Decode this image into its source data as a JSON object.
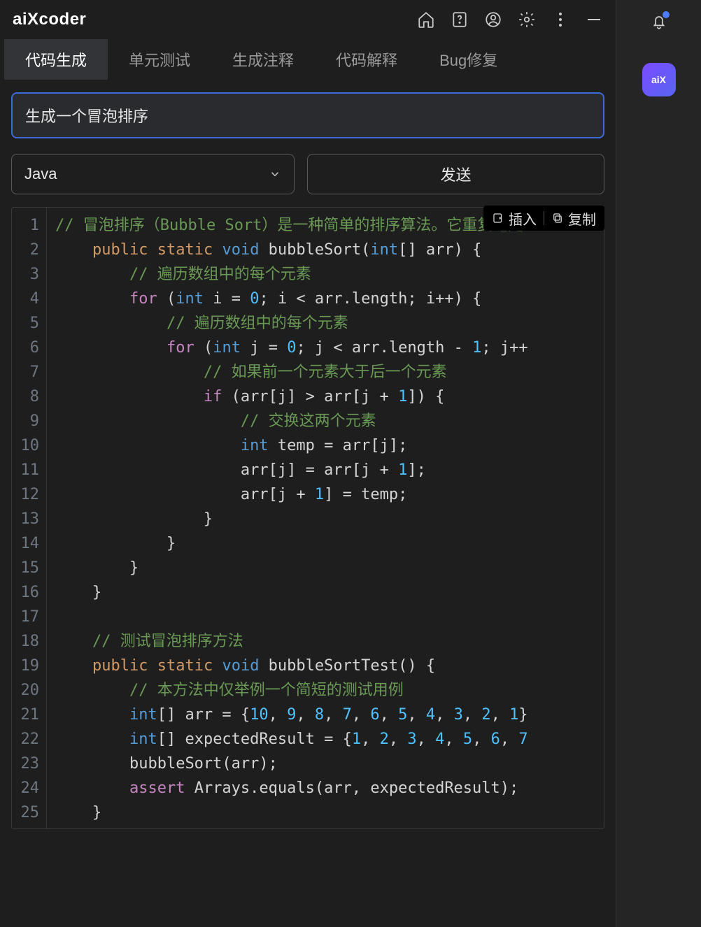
{
  "brand": "aiXcoder",
  "titlebar_icons": {
    "home": "home-icon",
    "help": "help-icon",
    "account": "account-icon",
    "settings": "settings-icon",
    "more": "more-icon",
    "minimize": "minimize-icon"
  },
  "tabs": [
    {
      "label": "代码生成",
      "active": true
    },
    {
      "label": "单元测试",
      "active": false
    },
    {
      "label": "生成注释",
      "active": false
    },
    {
      "label": "代码解释",
      "active": false
    },
    {
      "label": "Bug修复",
      "active": false
    }
  ],
  "prompt": {
    "value": "生成一个冒泡排序",
    "placeholder": ""
  },
  "language": {
    "selected": "Java"
  },
  "send_label": "发送",
  "action_bar": {
    "insert": "插入",
    "copy": "复制"
  },
  "code_lines": [
    {
      "n": 1,
      "tokens": [
        {
          "t": "comment",
          "v": "// 冒泡排序（Bubble Sort）是一种简单的排序算法。它重复地走"
        }
      ]
    },
    {
      "n": 2,
      "indent": "    ",
      "tokens": [
        {
          "t": "mod",
          "v": "public"
        },
        {
          "t": "plain",
          "v": " "
        },
        {
          "t": "mod",
          "v": "static"
        },
        {
          "t": "plain",
          "v": " "
        },
        {
          "t": "type",
          "v": "void"
        },
        {
          "t": "plain",
          "v": " bubbleSort("
        },
        {
          "t": "type",
          "v": "int"
        },
        {
          "t": "plain",
          "v": "[] arr) {"
        }
      ]
    },
    {
      "n": 3,
      "indent": "        ",
      "tokens": [
        {
          "t": "comment",
          "v": "// 遍历数组中的每个元素"
        }
      ]
    },
    {
      "n": 4,
      "indent": "        ",
      "tokens": [
        {
          "t": "keyword",
          "v": "for"
        },
        {
          "t": "plain",
          "v": " ("
        },
        {
          "t": "type",
          "v": "int"
        },
        {
          "t": "plain",
          "v": " i = "
        },
        {
          "t": "num",
          "v": "0"
        },
        {
          "t": "plain",
          "v": "; i < arr.length; i++) {"
        }
      ]
    },
    {
      "n": 5,
      "indent": "            ",
      "tokens": [
        {
          "t": "comment",
          "v": "// 遍历数组中的每个元素"
        }
      ]
    },
    {
      "n": 6,
      "indent": "            ",
      "tokens": [
        {
          "t": "keyword",
          "v": "for"
        },
        {
          "t": "plain",
          "v": " ("
        },
        {
          "t": "type",
          "v": "int"
        },
        {
          "t": "plain",
          "v": " j = "
        },
        {
          "t": "num",
          "v": "0"
        },
        {
          "t": "plain",
          "v": "; j < arr.length - "
        },
        {
          "t": "num",
          "v": "1"
        },
        {
          "t": "plain",
          "v": "; j++"
        }
      ]
    },
    {
      "n": 7,
      "indent": "                ",
      "tokens": [
        {
          "t": "comment",
          "v": "// 如果前一个元素大于后一个元素"
        }
      ]
    },
    {
      "n": 8,
      "indent": "                ",
      "tokens": [
        {
          "t": "keyword",
          "v": "if"
        },
        {
          "t": "plain",
          "v": " (arr[j] > arr[j + "
        },
        {
          "t": "num",
          "v": "1"
        },
        {
          "t": "plain",
          "v": "]) {"
        }
      ]
    },
    {
      "n": 9,
      "indent": "                    ",
      "tokens": [
        {
          "t": "comment",
          "v": "// 交换这两个元素"
        }
      ]
    },
    {
      "n": 10,
      "indent": "                    ",
      "tokens": [
        {
          "t": "type",
          "v": "int"
        },
        {
          "t": "plain",
          "v": " temp = arr[j];"
        }
      ]
    },
    {
      "n": 11,
      "indent": "                    ",
      "tokens": [
        {
          "t": "plain",
          "v": "arr[j] = arr[j + "
        },
        {
          "t": "num",
          "v": "1"
        },
        {
          "t": "plain",
          "v": "];"
        }
      ]
    },
    {
      "n": 12,
      "indent": "                    ",
      "tokens": [
        {
          "t": "plain",
          "v": "arr[j + "
        },
        {
          "t": "num",
          "v": "1"
        },
        {
          "t": "plain",
          "v": "] = temp;"
        }
      ]
    },
    {
      "n": 13,
      "indent": "                ",
      "tokens": [
        {
          "t": "plain",
          "v": "}"
        }
      ]
    },
    {
      "n": 14,
      "indent": "            ",
      "tokens": [
        {
          "t": "plain",
          "v": "}"
        }
      ]
    },
    {
      "n": 15,
      "indent": "        ",
      "tokens": [
        {
          "t": "plain",
          "v": "}"
        }
      ]
    },
    {
      "n": 16,
      "indent": "    ",
      "tokens": [
        {
          "t": "plain",
          "v": "}"
        }
      ]
    },
    {
      "n": 17,
      "indent": "",
      "tokens": []
    },
    {
      "n": 18,
      "indent": "    ",
      "tokens": [
        {
          "t": "comment",
          "v": "// 测试冒泡排序方法"
        }
      ]
    },
    {
      "n": 19,
      "indent": "    ",
      "tokens": [
        {
          "t": "mod",
          "v": "public"
        },
        {
          "t": "plain",
          "v": " "
        },
        {
          "t": "mod",
          "v": "static"
        },
        {
          "t": "plain",
          "v": " "
        },
        {
          "t": "type",
          "v": "void"
        },
        {
          "t": "plain",
          "v": " bubbleSortTest() {"
        }
      ]
    },
    {
      "n": 20,
      "indent": "        ",
      "tokens": [
        {
          "t": "comment",
          "v": "// 本方法中仅举例一个简短的测试用例"
        }
      ]
    },
    {
      "n": 21,
      "indent": "        ",
      "tokens": [
        {
          "t": "type",
          "v": "int"
        },
        {
          "t": "plain",
          "v": "[] arr = {"
        },
        {
          "t": "num",
          "v": "10"
        },
        {
          "t": "plain",
          "v": ", "
        },
        {
          "t": "num",
          "v": "9"
        },
        {
          "t": "plain",
          "v": ", "
        },
        {
          "t": "num",
          "v": "8"
        },
        {
          "t": "plain",
          "v": ", "
        },
        {
          "t": "num",
          "v": "7"
        },
        {
          "t": "plain",
          "v": ", "
        },
        {
          "t": "num",
          "v": "6"
        },
        {
          "t": "plain",
          "v": ", "
        },
        {
          "t": "num",
          "v": "5"
        },
        {
          "t": "plain",
          "v": ", "
        },
        {
          "t": "num",
          "v": "4"
        },
        {
          "t": "plain",
          "v": ", "
        },
        {
          "t": "num",
          "v": "3"
        },
        {
          "t": "plain",
          "v": ", "
        },
        {
          "t": "num",
          "v": "2"
        },
        {
          "t": "plain",
          "v": ", "
        },
        {
          "t": "num",
          "v": "1"
        },
        {
          "t": "plain",
          "v": "}"
        }
      ]
    },
    {
      "n": 22,
      "indent": "        ",
      "tokens": [
        {
          "t": "type",
          "v": "int"
        },
        {
          "t": "plain",
          "v": "[] expectedResult = {"
        },
        {
          "t": "num",
          "v": "1"
        },
        {
          "t": "plain",
          "v": ", "
        },
        {
          "t": "num",
          "v": "2"
        },
        {
          "t": "plain",
          "v": ", "
        },
        {
          "t": "num",
          "v": "3"
        },
        {
          "t": "plain",
          "v": ", "
        },
        {
          "t": "num",
          "v": "4"
        },
        {
          "t": "plain",
          "v": ", "
        },
        {
          "t": "num",
          "v": "5"
        },
        {
          "t": "plain",
          "v": ", "
        },
        {
          "t": "num",
          "v": "6"
        },
        {
          "t": "plain",
          "v": ", "
        },
        {
          "t": "num",
          "v": "7"
        }
      ]
    },
    {
      "n": 23,
      "indent": "        ",
      "tokens": [
        {
          "t": "plain",
          "v": "bubbleSort(arr);"
        }
      ]
    },
    {
      "n": 24,
      "indent": "        ",
      "tokens": [
        {
          "t": "keyword",
          "v": "assert"
        },
        {
          "t": "plain",
          "v": " Arrays.equals(arr, expectedResult);"
        }
      ]
    },
    {
      "n": 25,
      "indent": "    ",
      "tokens": [
        {
          "t": "plain",
          "v": "}"
        }
      ]
    }
  ],
  "right_rail": {
    "bell_has_badge": true,
    "app_badge_label": "aiX"
  }
}
